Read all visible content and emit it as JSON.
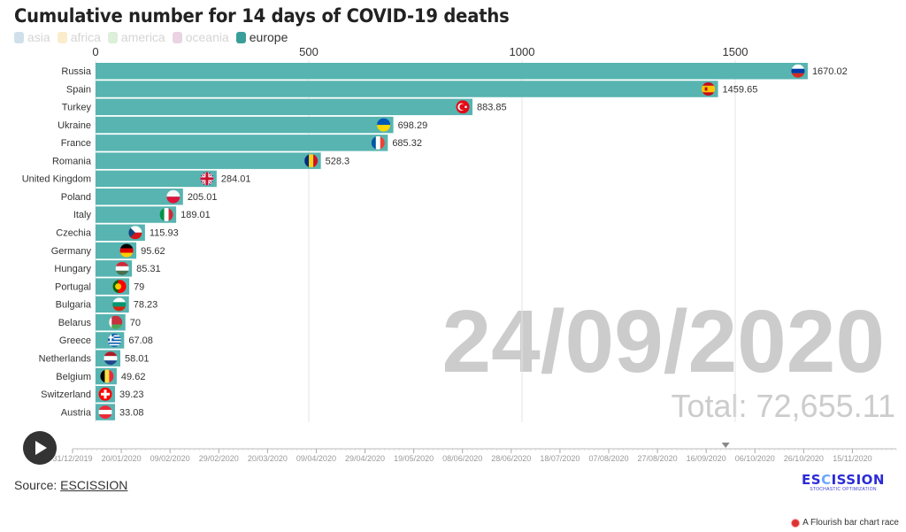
{
  "title": "Cumulative number for 14 days of COVID-19 deaths",
  "legend": [
    {
      "label": "asia",
      "color": "#cfe0ea",
      "active": false
    },
    {
      "label": "africa",
      "color": "#fbeccb",
      "active": false
    },
    {
      "label": "america",
      "color": "#dcefd9",
      "active": false
    },
    {
      "label": "oceania",
      "color": "#ead3e2",
      "active": false
    },
    {
      "label": "europe",
      "color": "#3a9e9a",
      "active": true
    }
  ],
  "chart_data": {
    "type": "bar",
    "orientation": "horizontal",
    "title": "Cumulative number for 14 days of COVID-19 deaths",
    "bar_color": "#57b4b0",
    "xlim": [
      0,
      1700
    ],
    "xticks": [
      0,
      500,
      1000,
      1500
    ],
    "xtick_labels": [
      "0",
      "500",
      "1000",
      "1500"
    ],
    "grid": true,
    "categories": [
      "Russia",
      "Spain",
      "Turkey",
      "Ukraine",
      "France",
      "Romania",
      "United Kingdom",
      "Poland",
      "Italy",
      "Czechia",
      "Germany",
      "Hungary",
      "Portugal",
      "Bulgaria",
      "Belarus",
      "Greece",
      "Netherlands",
      "Belgium",
      "Switzerland",
      "Austria"
    ],
    "values": [
      1670.02,
      1459.65,
      883.85,
      698.29,
      685.32,
      528.3,
      284.01,
      205.01,
      189.01,
      115.93,
      95.62,
      85.31,
      79,
      78.23,
      70,
      67.08,
      58.01,
      49.62,
      39.23,
      33.08
    ],
    "value_labels": [
      "1670.02",
      "1459.65",
      "883.85",
      "698.29",
      "685.32",
      "528.3",
      "284.01",
      "205.01",
      "189.01",
      "115.93",
      "95.62",
      "85.31",
      "79",
      "78.23",
      "70",
      "67.08",
      "58.01",
      "49.62",
      "39.23",
      "33.08"
    ],
    "flags": [
      "russia",
      "spain",
      "turkey",
      "ukraine",
      "france",
      "romania",
      "united-kingdom",
      "poland",
      "italy",
      "czechia",
      "germany",
      "hungary",
      "portugal",
      "bulgaria",
      "belarus",
      "greece",
      "netherlands",
      "belgium",
      "switzerland",
      "austria"
    ],
    "current_date": "24/09/2020",
    "total_label": "Total: 72,655.11",
    "legend_position": "top-left"
  },
  "timeline": {
    "tick_labels": [
      "31/12/2019",
      "20/01/2020",
      "09/02/2020",
      "29/02/2020",
      "20/03/2020",
      "09/04/2020",
      "29/04/2020",
      "19/05/2020",
      "08/06/2020",
      "28/06/2020",
      "18/07/2020",
      "07/08/2020",
      "27/08/2020",
      "16/09/2020",
      "06/10/2020",
      "26/10/2020",
      "15/11/2020"
    ],
    "total_days": 338,
    "current_day": 268,
    "play_icon": "play-icon"
  },
  "footer": {
    "source_prefix": "Source: ",
    "source_link": "ESCISSION",
    "logo_main_a": "ES",
    "logo_main_b": "C",
    "logo_main_c": "ISSION",
    "logo_sub": "STOCHASTIC OPTIMIZATION",
    "flourish": "A Flourish bar chart race"
  }
}
